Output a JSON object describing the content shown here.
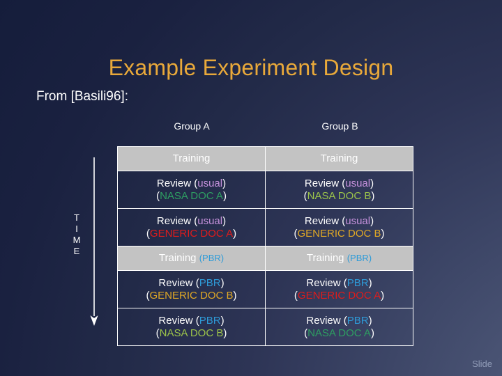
{
  "slide": {
    "title": "Example Experiment Design",
    "source": "From [Basili96]:",
    "footer": "Slide",
    "time_axis": {
      "letters": [
        "T",
        "I",
        "M",
        "E"
      ],
      "arrow_direction": "down"
    }
  },
  "colors": {
    "title": "#e9a93a",
    "background_dark": "#151d3b",
    "background_light": "#5a6488",
    "shaded_row": "#c3c3c3",
    "border": "#ffffff",
    "usual": "#c792dd",
    "pbr": "#2e9bd8",
    "nasa_doc_a": "#2e9e62",
    "nasa_doc_b": "#9cc44a",
    "generic_doc_a": "#e01b1b",
    "generic_doc_b": "#e0a825",
    "footer": "#919cb8"
  },
  "table": {
    "columns": [
      "Group A",
      "Group B"
    ],
    "rows": [
      {
        "shaded": true,
        "cells": [
          {
            "line1_main": "Training",
            "line1_token": "",
            "line2_open": "",
            "line2_token": "",
            "line2_close": ""
          },
          {
            "line1_main": "Training",
            "line1_token": "",
            "line2_open": "",
            "line2_token": "",
            "line2_close": ""
          }
        ]
      },
      {
        "shaded": false,
        "cells": [
          {
            "line1_main": "Review (",
            "line1_token": "usual",
            "line1_close": ")",
            "line2_open": "(",
            "line2_token": "NASA DOC A",
            "line2_close": ")"
          },
          {
            "line1_main": "Review (",
            "line1_token": "usual",
            "line1_close": ")",
            "line2_open": "(",
            "line2_token": "NASA DOC B",
            "line2_close": ")"
          }
        ]
      },
      {
        "shaded": false,
        "cells": [
          {
            "line1_main": "Review (",
            "line1_token": "usual",
            "line1_close": ")",
            "line2_open": "(",
            "line2_token": "GENERIC DOC A",
            "line2_close": ")"
          },
          {
            "line1_main": "Review (",
            "line1_token": "usual",
            "line1_close": ")",
            "line2_open": "(",
            "line2_token": "GENERIC DOC B",
            "line2_close": ")"
          }
        ]
      },
      {
        "shaded": true,
        "cells": [
          {
            "line1_main": "Training ",
            "line1_token": "(PBR)",
            "line1_close": "",
            "line2_open": "",
            "line2_token": "",
            "line2_close": ""
          },
          {
            "line1_main": "Training ",
            "line1_token": "(PBR)",
            "line1_close": "",
            "line2_open": "",
            "line2_token": "",
            "line2_close": ""
          }
        ]
      },
      {
        "shaded": false,
        "cells": [
          {
            "line1_main": "Review (",
            "line1_token": "PBR",
            "line1_close": ")",
            "line2_open": "(",
            "line2_token": "GENERIC DOC B",
            "line2_close": ")"
          },
          {
            "line1_main": "Review (",
            "line1_token": "PBR",
            "line1_close": ")",
            "line2_open": "(",
            "line2_token": "GENERIC DOC A",
            "line2_close": ")"
          }
        ]
      },
      {
        "shaded": false,
        "cells": [
          {
            "line1_main": "Review (",
            "line1_token": "PBR",
            "line1_close": ")",
            "line2_open": "(",
            "line2_token": "NASA DOC B",
            "line2_close": ")"
          },
          {
            "line1_main": "Review (",
            "line1_token": "PBR",
            "line1_close": ")",
            "line2_open": "(",
            "line2_token": "NASA DOC A",
            "line2_close": ")"
          }
        ]
      }
    ]
  }
}
